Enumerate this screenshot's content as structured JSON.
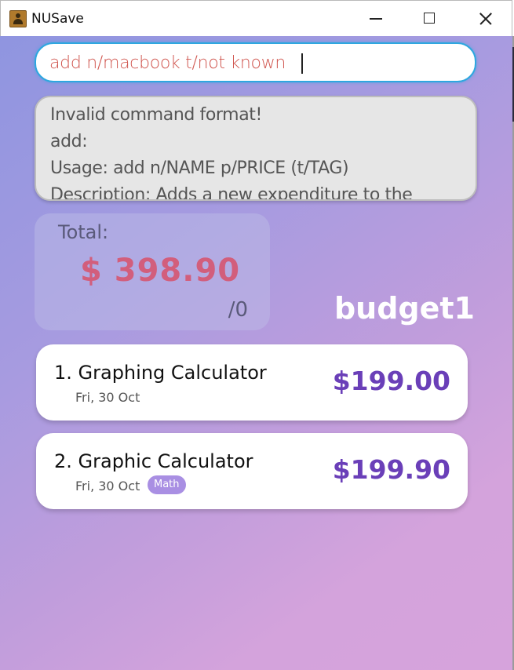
{
  "window": {
    "title": "NUSave",
    "icon": "app-icon"
  },
  "command_box": {
    "value": "add n/macbook t/not known"
  },
  "result_display": {
    "lines": [
      "Invalid command format!",
      "add:",
      "Usage: add n/NAME p/PRICE (t/TAG)",
      "Description: Adds a new expenditure to the"
    ]
  },
  "summary": {
    "total_label": "Total:",
    "total_value": "$ 398.90",
    "budget_limit": "/0",
    "budget_name": "budget1"
  },
  "expenditures": [
    {
      "title": "1. Graphing Calculator",
      "date": "Fri, 30 Oct",
      "price": "$199.00",
      "tag": ""
    },
    {
      "title": "2. Graphic Calculator",
      "date": "Fri, 30 Oct",
      "price": "$199.90",
      "tag": "Math"
    }
  ],
  "colors": {
    "accent_focus": "#2ea7df",
    "command_text": "#d0564f",
    "total_value": "#d25e7c",
    "price": "#6a3fb8",
    "tag_bg": "#a98fe3"
  }
}
